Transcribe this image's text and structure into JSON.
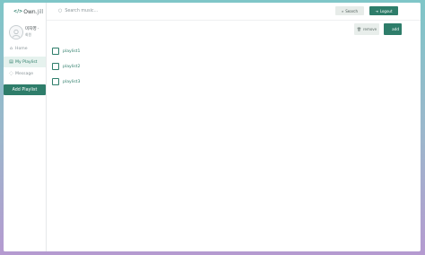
{
  "app": {
    "logo_mark": "</>",
    "logo_text_1": "Own.",
    "logo_text_2": "Jill"
  },
  "profile": {
    "name": "미자영 ·",
    "role": "회원"
  },
  "sidebar": {
    "items": [
      {
        "label": "Home",
        "icon": "home-icon"
      },
      {
        "label": "My Playlist",
        "icon": "list-icon"
      },
      {
        "label": "Message",
        "icon": "message-icon"
      }
    ],
    "add_playlist_label": "Add Playlist"
  },
  "topbar": {
    "search_placeholder": "Search music...",
    "search_button": "Search",
    "logout_button": "Logout"
  },
  "actions": {
    "remove_label": "remove",
    "add_label": "add"
  },
  "playlists": [
    {
      "label": "playlist1"
    },
    {
      "label": "playlist2"
    },
    {
      "label": "playlist3"
    }
  ],
  "colors": {
    "accent": "#2e7d6a",
    "accent_light": "#e6f2ee"
  }
}
